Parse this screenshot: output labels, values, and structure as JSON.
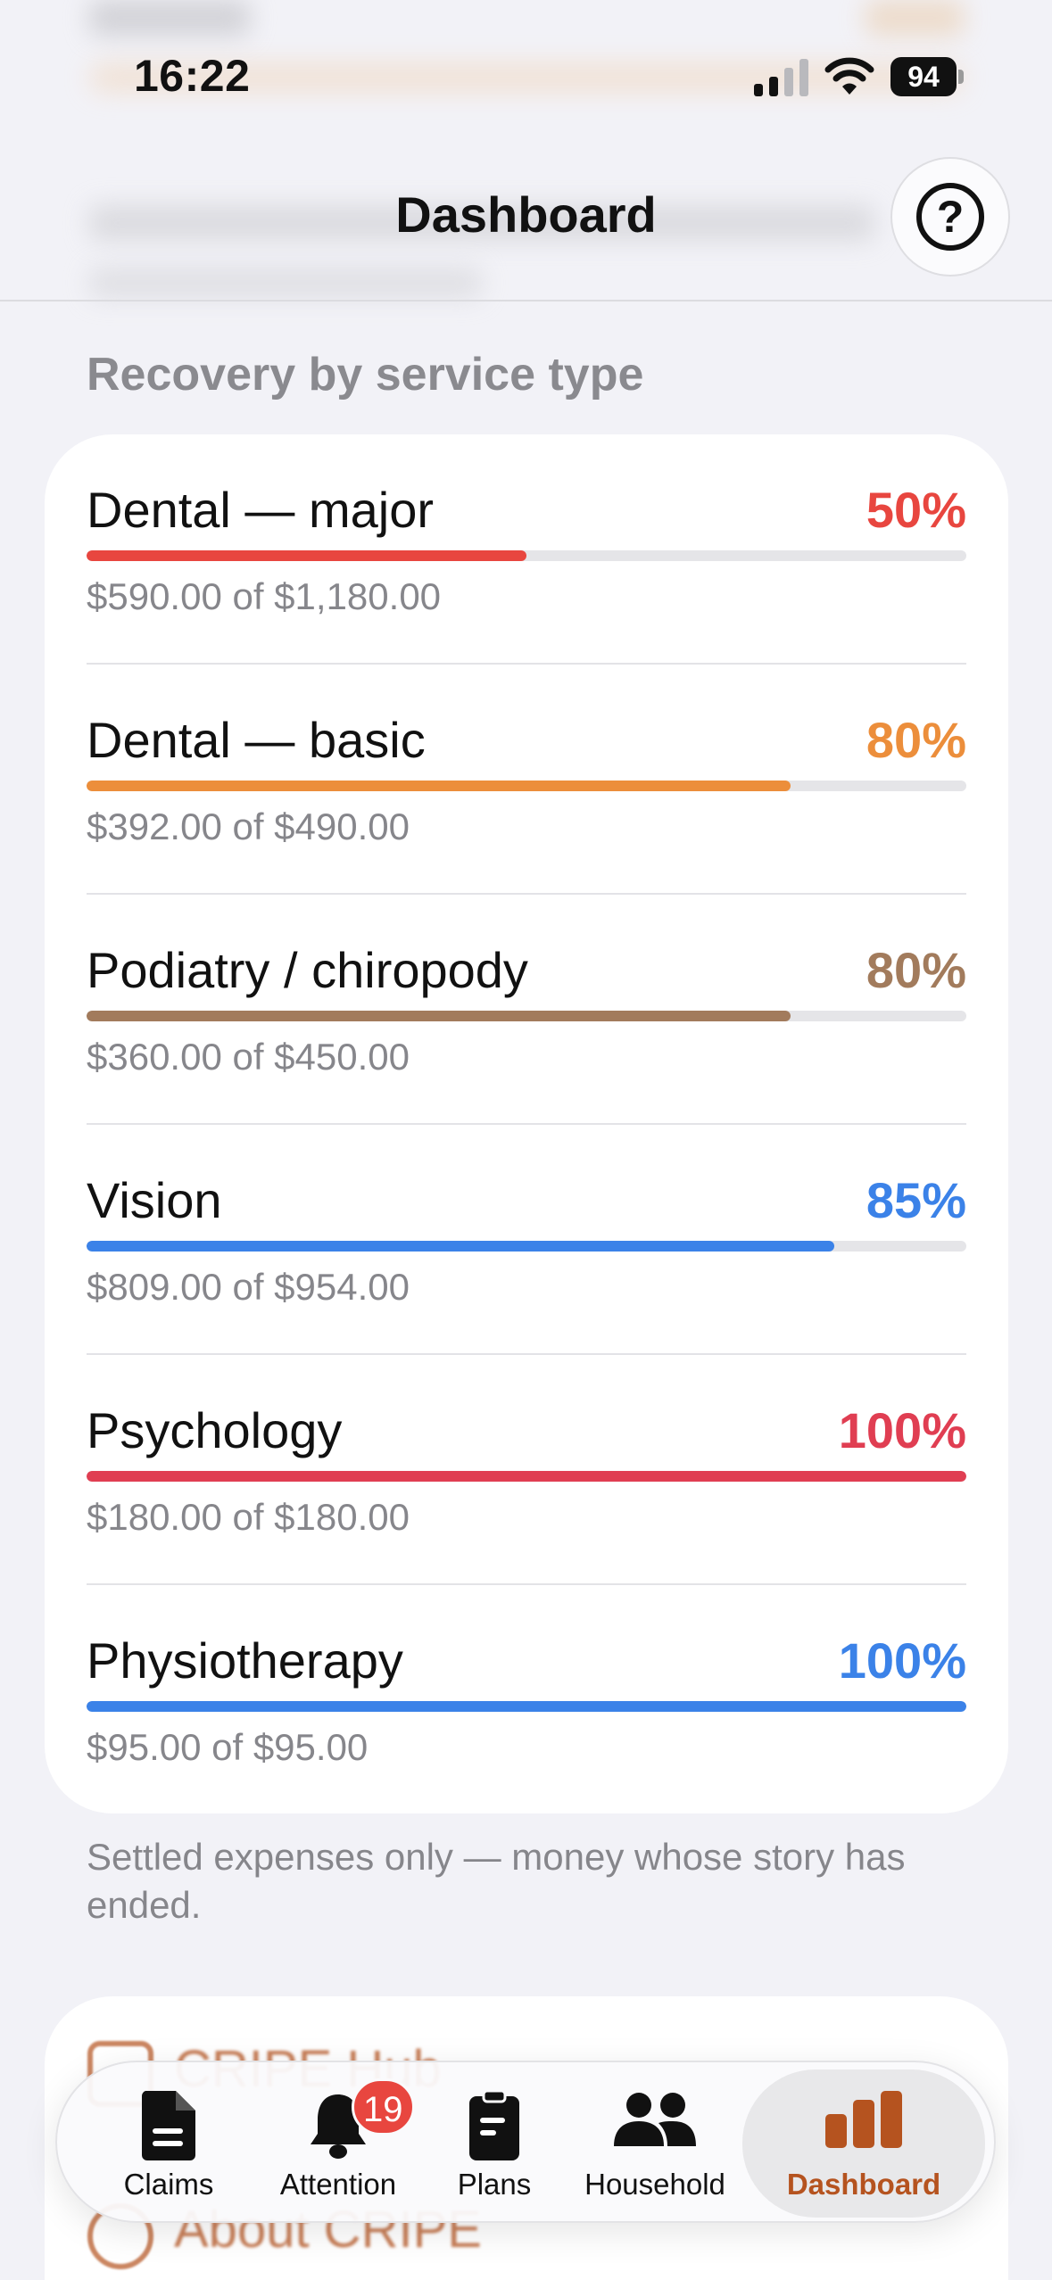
{
  "status_bar": {
    "time": "16:22",
    "battery": "94"
  },
  "header": {
    "title": "Dashboard",
    "help_label": "?"
  },
  "section": {
    "title": "Recovery by service type",
    "rows": [
      {
        "name": "Dental — major",
        "percent": "50%",
        "fraction": 0.5,
        "amount": "$590.00 of $1,180.00",
        "color": "#e8463f"
      },
      {
        "name": "Dental — basic",
        "percent": "80%",
        "fraction": 0.8,
        "amount": "$392.00 of $490.00",
        "color": "#ec8e3b"
      },
      {
        "name": "Podiatry / chiropody",
        "percent": "80%",
        "fraction": 0.8,
        "amount": "$360.00 of $450.00",
        "color": "#a27b5c"
      },
      {
        "name": "Vision",
        "percent": "85%",
        "fraction": 0.85,
        "amount": "$809.00 of $954.00",
        "color": "#3b82e8"
      },
      {
        "name": "Psychology",
        "percent": "100%",
        "fraction": 1.0,
        "amount": "$180.00 of $180.00",
        "color": "#e03e52"
      },
      {
        "name": "Physiotherapy",
        "percent": "100%",
        "fraction": 1.0,
        "amount": "$95.00 of $95.00",
        "color": "#3b82e8"
      }
    ],
    "footnote": "Settled expenses only — money whose story has ended."
  },
  "links": {
    "first": "CRIPE Hub",
    "second": "About CRIPE"
  },
  "tab_bar": {
    "tabs": [
      {
        "label": "Claims",
        "icon": "document-icon"
      },
      {
        "label": "Attention",
        "icon": "bell-icon",
        "badge": "19"
      },
      {
        "label": "Plans",
        "icon": "clipboard-icon"
      },
      {
        "label": "Household",
        "icon": "people-icon"
      },
      {
        "label": "Dashboard",
        "icon": "bar-chart-icon",
        "active": true
      }
    ],
    "accent": "#b5531f"
  }
}
